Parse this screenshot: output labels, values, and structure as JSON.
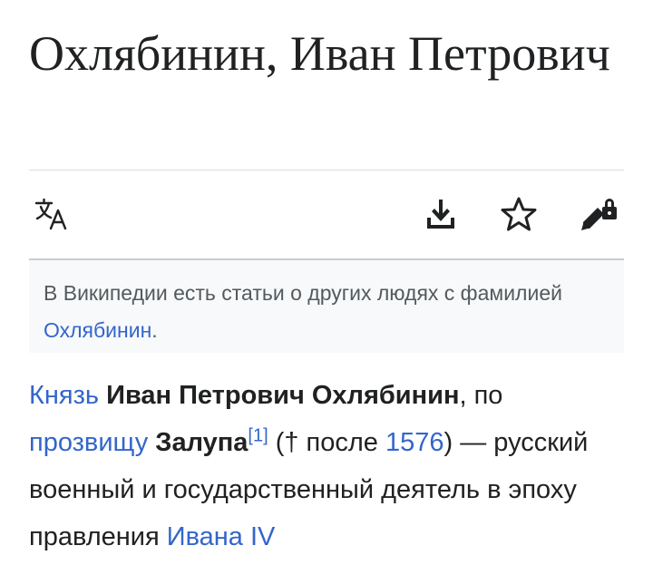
{
  "article": {
    "title": "Охлябинин, Иван Петрович"
  },
  "toolbar": {
    "language_icon": "translate-icon",
    "download_icon": "download-icon",
    "watch_icon": "star-icon",
    "edit_icon": "edit-locked-icon"
  },
  "hatnote": {
    "text_before": "В Википедии есть статьи о других людях с фамилией ",
    "link_text": "Охлябинин",
    "text_after": "."
  },
  "lead": {
    "link_knyaz": "Князь",
    "bold_name": "Иван Петрович Охлябинин",
    "text_1": ", по ",
    "link_prozvishchu": "прозвищу",
    "bold_nickname": "Залупа",
    "ref_label": "[1]",
    "text_2": " († после ",
    "link_year": "1576",
    "text_3": ") — русский военный и государственный деятель в эпоху правления ",
    "link_ivan": "Ивана IV"
  },
  "colors": {
    "link": "#3366cc",
    "text": "#202122",
    "muted": "#54595d",
    "hatnote_bg": "#f8f9fa",
    "rule": "#dcdee2"
  }
}
